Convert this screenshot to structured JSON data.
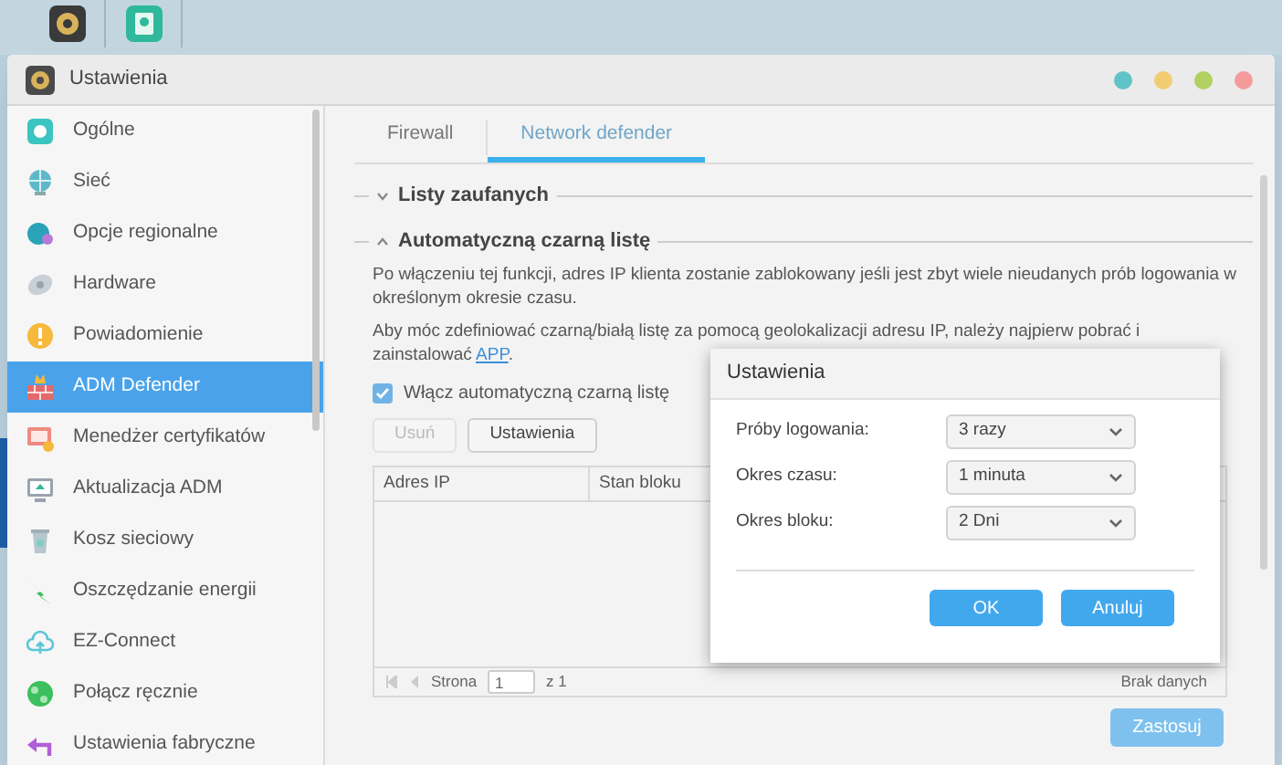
{
  "window": {
    "title": "Ustawienia"
  },
  "sidebar": {
    "items": [
      {
        "label": "Ogólne",
        "kind": "general",
        "selected": false
      },
      {
        "label": "Sieć",
        "kind": "network",
        "selected": false
      },
      {
        "label": "Opcje regionalne",
        "kind": "regional",
        "selected": false
      },
      {
        "label": "Hardware",
        "kind": "hardware",
        "selected": false
      },
      {
        "label": "Powiadomienie",
        "kind": "notification",
        "selected": false
      },
      {
        "label": "ADM Defender",
        "kind": "defender",
        "selected": true
      },
      {
        "label": "Menedżer certyfikatów",
        "kind": "certificate",
        "selected": false
      },
      {
        "label": "Aktualizacja ADM",
        "kind": "update",
        "selected": false
      },
      {
        "label": "Kosz sieciowy",
        "kind": "recycle",
        "selected": false
      },
      {
        "label": "Oszczędzanie energii",
        "kind": "energy",
        "selected": false
      },
      {
        "label": "EZ-Connect",
        "kind": "ezconnect",
        "selected": false
      },
      {
        "label": "Połącz ręcznie",
        "kind": "manual",
        "selected": false
      },
      {
        "label": "Ustawienia fabryczne",
        "kind": "reset",
        "selected": false
      }
    ]
  },
  "tabs": [
    {
      "label": "Firewall",
      "selected": false
    },
    {
      "label": "Network defender",
      "selected": true
    }
  ],
  "sections": [
    {
      "title": "Listy zaufanych",
      "expanded": false
    },
    {
      "title": "Automatyczną czarną listę",
      "expanded": true
    }
  ],
  "description": "Po włączeniu tej funkcji, adres IP klienta zostanie zablokowany jeśli jest zbyt wiele nieudanych prób logowania w określonym okresie czasu.",
  "geo_note": {
    "text": "Aby móc zdefiniować czarną/białą listę za pomocą geolokalizacji adresu IP, należy najpierw pobrać i zainstalować",
    "link": "APP",
    "after": "."
  },
  "auto_blacklist": {
    "label": "Włącz automatyczną czarną listę",
    "checked": true
  },
  "buttons": [
    {
      "label": "Usuń",
      "disabled": true
    },
    {
      "label": "Ustawienia",
      "disabled": false
    }
  ],
  "table": {
    "columns": [
      "Adres IP",
      "Stan bloku"
    ],
    "pager": {
      "page_label": "Strona",
      "page": "1",
      "of": "z 1",
      "status": "Brak danych"
    }
  },
  "apply_button": {
    "label": "Zastosuj",
    "disabled": true
  },
  "dialog": {
    "title": "Ustawienia",
    "fields": [
      {
        "label": "Próby logowania:",
        "value": "3 razy"
      },
      {
        "label": "Okres czasu:",
        "value": "1 minuta"
      },
      {
        "label": "Okres bloku:",
        "value": "2 Dni"
      }
    ],
    "buttons": [
      "OK",
      "Anuluj"
    ]
  }
}
